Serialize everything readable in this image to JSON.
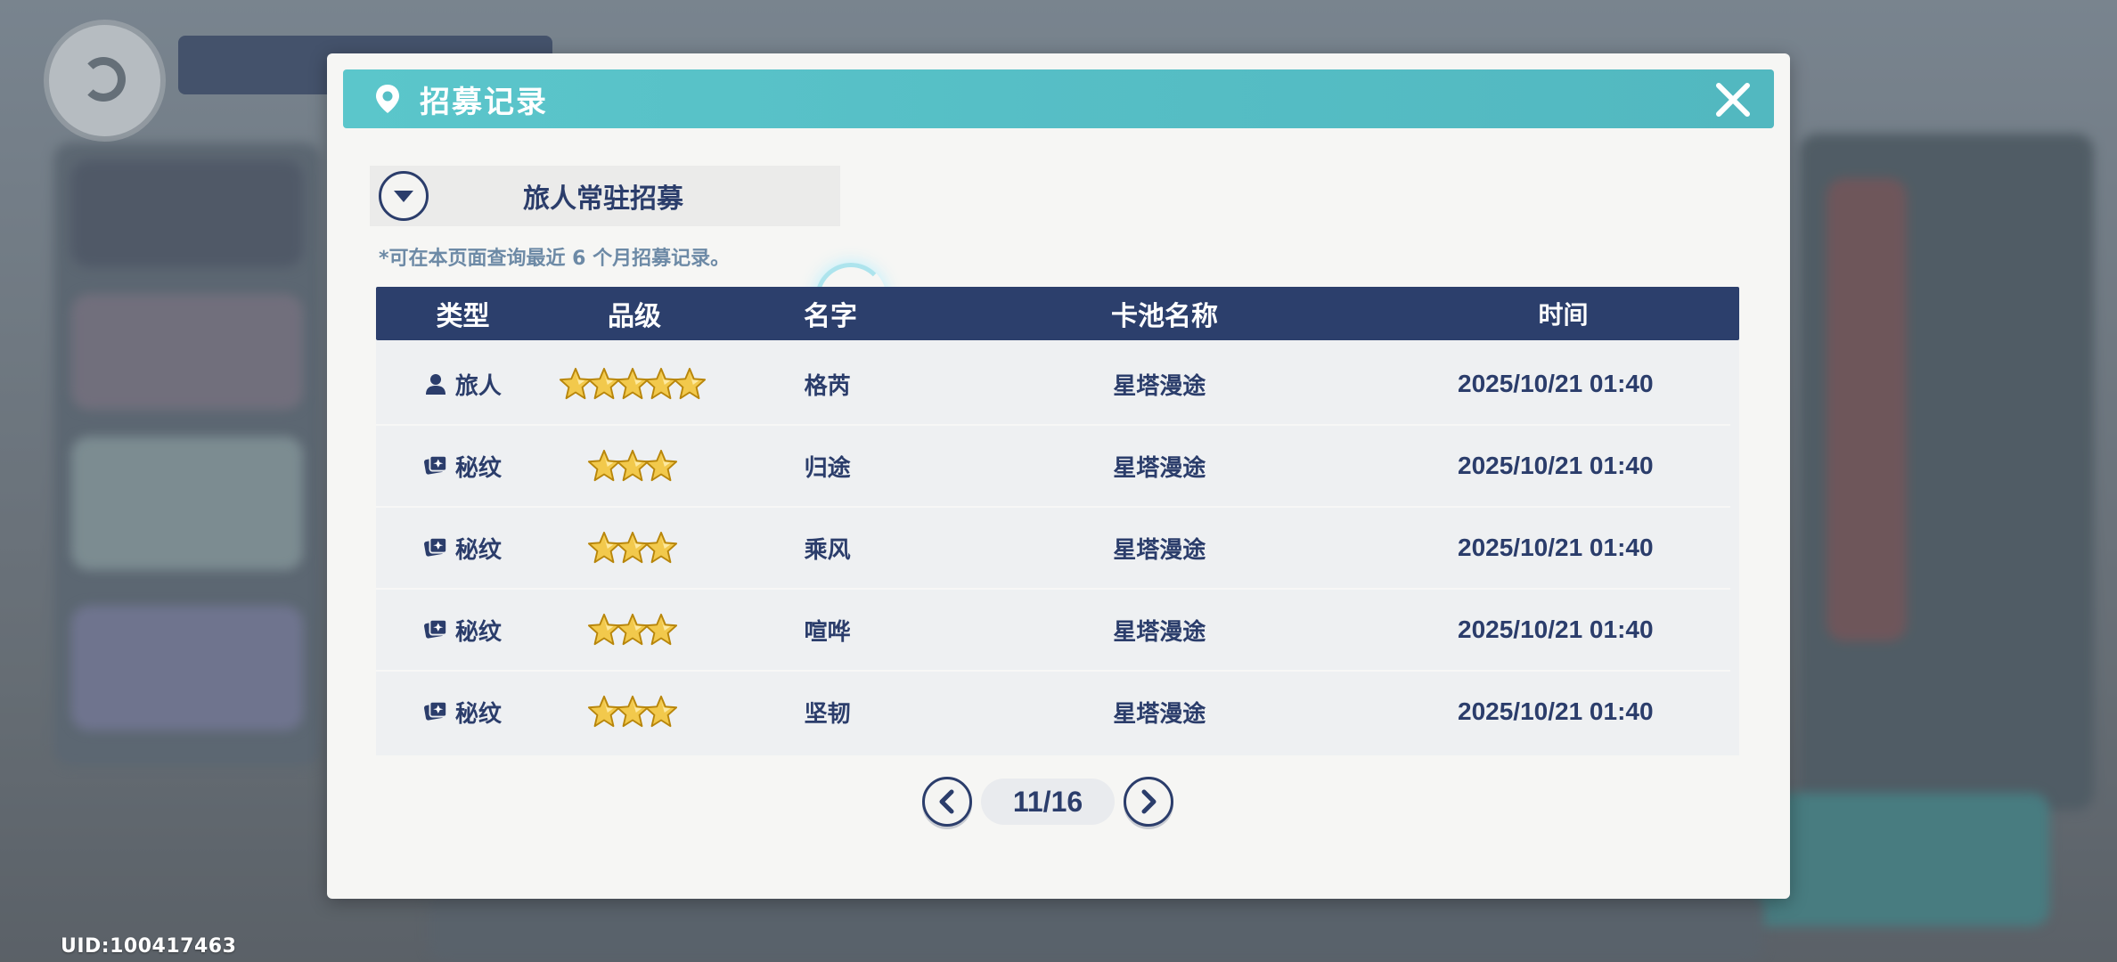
{
  "uid_text": "UID:100417463",
  "modal": {
    "title": "招募记录",
    "pool_selected": "旅人常驻招募",
    "note": "*可在本页面查询最近 6 个月招募记录。"
  },
  "table": {
    "headers": {
      "type": "类型",
      "rank": "品级",
      "name": "名字",
      "pool": "卡池名称",
      "time": "时间"
    },
    "rows": [
      {
        "type": "旅人",
        "type_icon": "person-icon",
        "stars": 5,
        "name": "格芮",
        "pool": "星塔漫途",
        "time": "2025/10/21 01:40"
      },
      {
        "type": "秘纹",
        "type_icon": "card-icon",
        "stars": 3,
        "name": "归途",
        "pool": "星塔漫途",
        "time": "2025/10/21 01:40"
      },
      {
        "type": "秘纹",
        "type_icon": "card-icon",
        "stars": 3,
        "name": "乘风",
        "pool": "星塔漫途",
        "time": "2025/10/21 01:40"
      },
      {
        "type": "秘纹",
        "type_icon": "card-icon",
        "stars": 3,
        "name": "喧哗",
        "pool": "星塔漫途",
        "time": "2025/10/21 01:40"
      },
      {
        "type": "秘纹",
        "type_icon": "card-icon",
        "stars": 3,
        "name": "坚韧",
        "pool": "星塔漫途",
        "time": "2025/10/21 01:40"
      }
    ]
  },
  "pagination": {
    "current": 11,
    "total": 16,
    "label": "11/16"
  },
  "colors": {
    "header_teal": "#56bfc6",
    "navy": "#2c3f6c",
    "star_gold": "#f2c94c"
  }
}
